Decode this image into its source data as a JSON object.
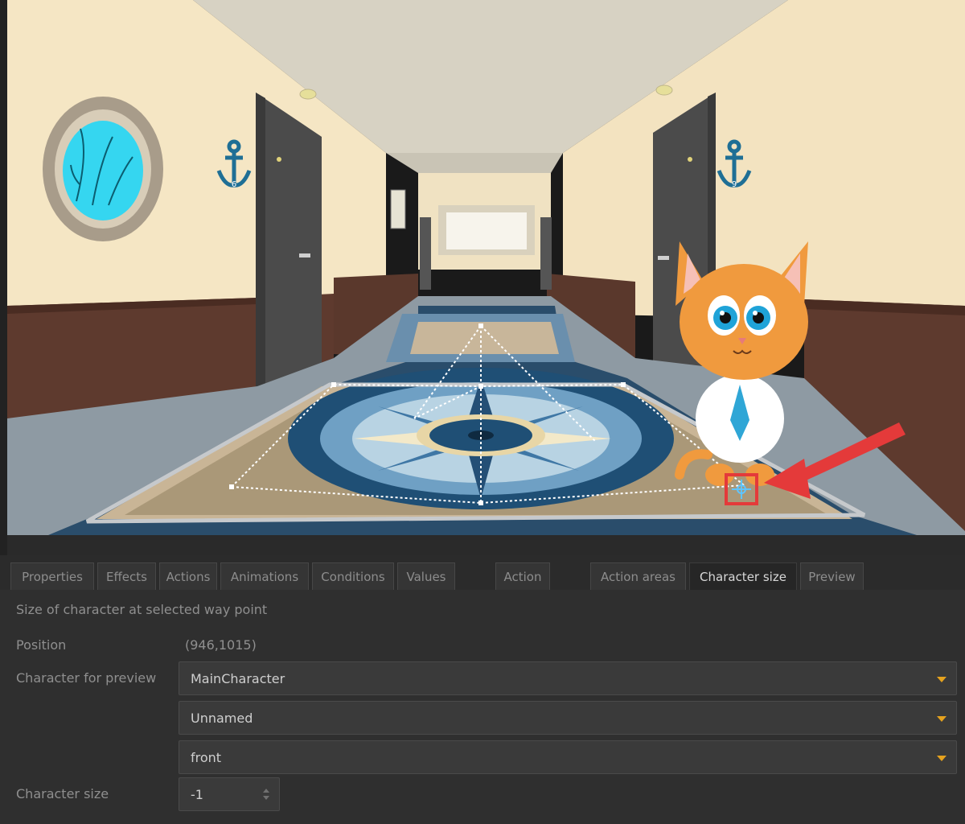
{
  "tabs_left": [
    "Properties",
    "Effects",
    "Actions",
    "Animations",
    "Conditions",
    "Values"
  ],
  "tab_action": "Action",
  "tabs_right": [
    "Action areas",
    "Character size",
    "Preview"
  ],
  "active_tab": "Character size",
  "panel": {
    "caption": "Size of character at selected way point",
    "position_label": "Position",
    "position_value": "(946,1015)",
    "character_preview_label": "Character for preview",
    "character_select": "MainCharacter",
    "outfit_select": "Unnamed",
    "direction_select": "front",
    "character_size_label": "Character size",
    "character_size_value": "-1"
  },
  "scene": {
    "door_number_left": "6",
    "door_number_right": "9"
  },
  "colors": {
    "accent_arrow": "#e5a21e",
    "highlight_red": "#e43a3a",
    "panel_bg": "#2f2f2f"
  }
}
